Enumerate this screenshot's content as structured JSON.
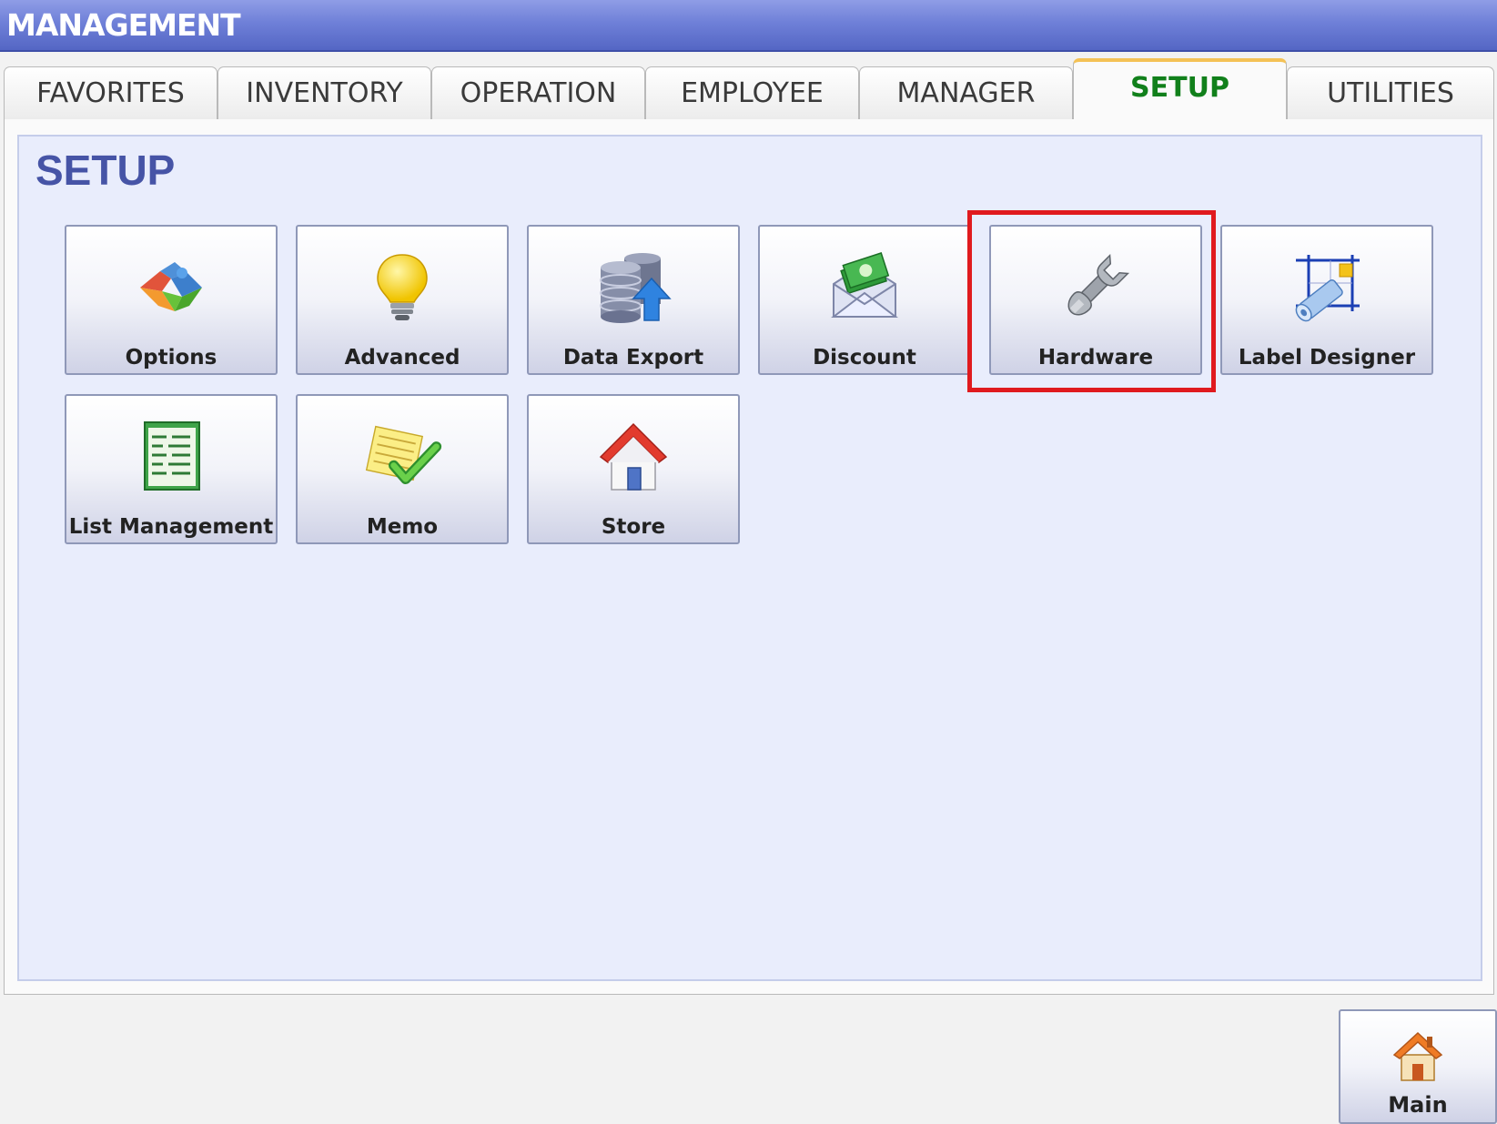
{
  "window": {
    "title": "MANAGEMENT"
  },
  "tabs": [
    {
      "label": "FAVORITES",
      "active": false
    },
    {
      "label": "INVENTORY",
      "active": false
    },
    {
      "label": "OPERATION",
      "active": false
    },
    {
      "label": "EMPLOYEE",
      "active": false
    },
    {
      "label": "MANAGER",
      "active": false
    },
    {
      "label": "SETUP",
      "active": true
    },
    {
      "label": "UTILITIES",
      "active": false
    }
  ],
  "panel": {
    "title": "SETUP",
    "tiles": [
      {
        "label": "Options",
        "icon": "puzzle-icon"
      },
      {
        "label": "Advanced",
        "icon": "lightbulb-icon"
      },
      {
        "label": "Data Export",
        "icon": "database-upload-icon"
      },
      {
        "label": "Discount",
        "icon": "money-envelope-icon"
      },
      {
        "label": "Hardware",
        "icon": "wrench-icon",
        "highlighted": true
      },
      {
        "label": "Label Designer",
        "icon": "label-roll-icon"
      },
      {
        "label": "List Management",
        "icon": "list-document-icon"
      },
      {
        "label": "Memo",
        "icon": "memo-check-icon"
      },
      {
        "label": "Store",
        "icon": "house-icon"
      }
    ]
  },
  "footer": {
    "main_label": "Main",
    "main_icon": "home-icon"
  },
  "colors": {
    "highlight": "#e01a1e",
    "active_tab_text": "#11801b",
    "panel_title": "#4654a6"
  }
}
